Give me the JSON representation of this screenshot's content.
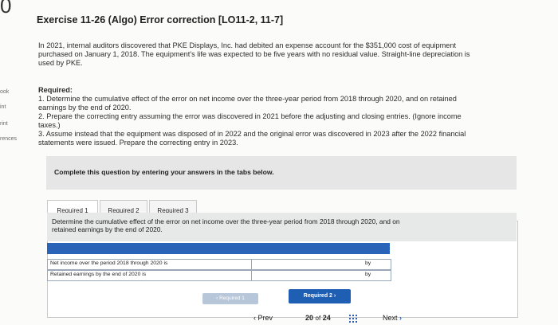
{
  "corner": {
    "number": "0"
  },
  "sidebar": {
    "fragments": [
      "ook",
      "int",
      "rint",
      "rences"
    ]
  },
  "header": {
    "title": "Exercise 11-26 (Algo) Error correction [LO11-2, 11-7]"
  },
  "problem": {
    "intro_line1": "In 2021, internal auditors discovered that PKE Displays, Inc. had debited an expense account for the $351,000 cost of equipment",
    "intro_line2": "purchased on January 1, 2018. The equipment's life was expected to be five years with no residual value. Straight-line depreciation is",
    "intro_line3": "used by PKE.",
    "required_heading": "Required:",
    "req1_line1": "1. Determine the cumulative effect of the error on net income over the three-year period from 2018 through 2020, and on retained",
    "req1_line2": "earnings by the end of 2020.",
    "req2_line1": "2. Prepare the correcting entry assuming the error was discovered in 2021 before the adjusting and closing entries. (Ignore income",
    "req2_line2": "taxes.)",
    "req3_line1": "3. Assume instead that the equipment was disposed of in 2022 and the original error was discovered in 2023 after the 2022 financial",
    "req3_line2": "statements were issued. Prepare the correcting entry in 2023."
  },
  "instructions": {
    "text": "Complete this question by entering your answers in the tabs below."
  },
  "tabs": [
    {
      "label": "Required 1",
      "active": true
    },
    {
      "label": "Required 2",
      "active": false
    },
    {
      "label": "Required 3",
      "active": false
    }
  ],
  "tab_description": {
    "line1": "Determine the cumulative effect of the error on net income over the three-year period from 2018 through 2020, and on",
    "line2": "retained earnings by the end of 2020."
  },
  "answer_table": {
    "rows": [
      {
        "label": "Net income over the period 2018 through 2020 is",
        "value": "",
        "suffix": "by"
      },
      {
        "label": "Retained earnings by the end of 2020 is",
        "value": "",
        "suffix": "by"
      }
    ]
  },
  "nav_buttons": {
    "prev_label": "Required 1",
    "next_label": "Required 2"
  },
  "footer": {
    "prev": "Prev",
    "page_current": "20",
    "of": "of",
    "page_total": "24",
    "next": "Next"
  },
  "colors": {
    "accent": "#1f5fb3",
    "table_header": "#2a64b8",
    "gray_box": "#e6e6e6"
  }
}
